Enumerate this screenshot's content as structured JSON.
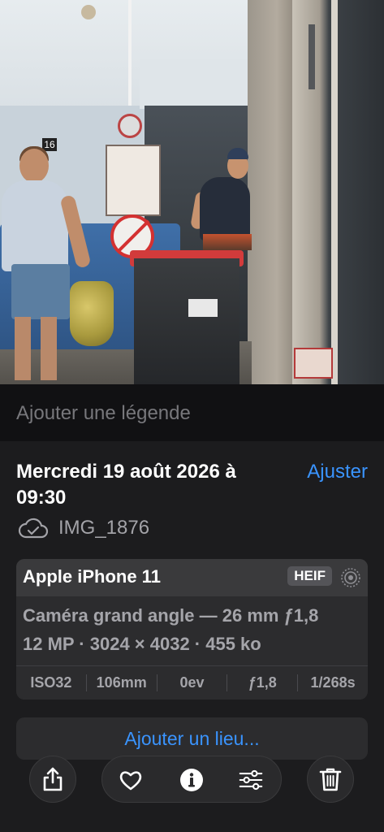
{
  "caption": {
    "placeholder": "Ajouter une légende"
  },
  "header": {
    "date": "Mercredi 19 août 2026 à 09:30",
    "adjust_label": "Ajuster"
  },
  "file": {
    "name": "IMG_1876",
    "icon": "cloud-check-icon"
  },
  "camera_card": {
    "device": "Apple iPhone 11",
    "format_badge": "HEIF",
    "lens": "Caméra grand angle — 26 mm ƒ1,8",
    "specs": "12 MP · 3024 × 4032 · 455 ko",
    "exif": [
      "ISO32",
      "106mm",
      "0ev",
      "ƒ1,8",
      "1/268s"
    ]
  },
  "location": {
    "label": "Ajouter un lieu..."
  },
  "photo": {
    "sign_number": "16"
  },
  "toolbar": {
    "icons": [
      "share-icon",
      "heart-icon",
      "info-icon",
      "sliders-icon",
      "trash-icon"
    ]
  },
  "colors": {
    "accent": "#3a94ff",
    "panel": "#1c1c1e",
    "card": "#2c2c2e"
  }
}
